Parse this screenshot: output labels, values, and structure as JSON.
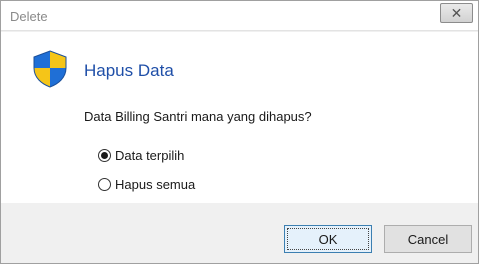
{
  "window": {
    "title": "Delete",
    "close_icon": "close-icon"
  },
  "dialog": {
    "icon": "uac-shield-icon",
    "heading": "Hapus Data",
    "question": "Data Billing Santri mana yang dihapus?",
    "options": [
      {
        "label": "Data terpilih",
        "checked": true
      },
      {
        "label": "Hapus semua",
        "checked": false
      }
    ]
  },
  "buttons": {
    "ok_label": "OK",
    "cancel_label": "Cancel"
  },
  "colors": {
    "heading": "#1f4fa8",
    "shield_blue": "#1f6fd6",
    "shield_yellow": "#f5c518",
    "content_bg": "#ffffff",
    "footer_bg": "#f0f0f0"
  }
}
